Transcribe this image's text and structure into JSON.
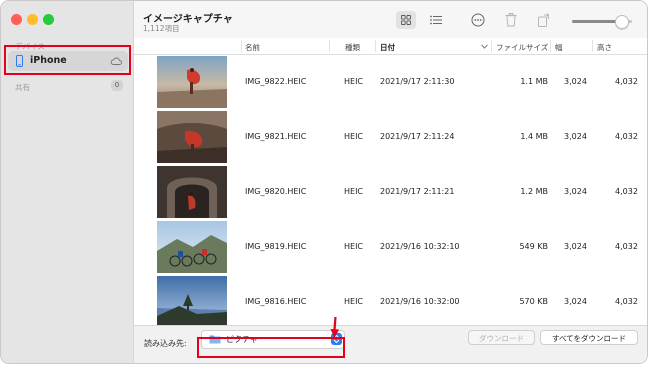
{
  "sidebar": {
    "devices_section": "デバイス",
    "device_name": "iPhone",
    "shared_section": "共有",
    "shared_count": "0"
  },
  "toolbar": {
    "title": "イメージキャプチャ",
    "subtitle": "1,112項目",
    "icons": [
      "grid-view-icon",
      "list-view-icon",
      "more-icon",
      "trash-icon",
      "rotate-icon"
    ],
    "zoom_level": 0.9
  },
  "table": {
    "headers": {
      "name": "名前",
      "kind": "種類",
      "date": "日付",
      "size": "ファイルサイズ",
      "width": "幅",
      "height": "高さ"
    },
    "rows": [
      {
        "name": "IMG_9822.HEIC",
        "kind": "HEIC",
        "date": "2021/9/17 2:11:30",
        "size": "1.1 MB",
        "width": "3,024",
        "height": "4,032"
      },
      {
        "name": "IMG_9821.HEIC",
        "kind": "HEIC",
        "date": "2021/9/17 2:11:24",
        "size": "1.4 MB",
        "width": "3,024",
        "height": "4,032"
      },
      {
        "name": "IMG_9820.HEIC",
        "kind": "HEIC",
        "date": "2021/9/17 2:11:21",
        "size": "1.2 MB",
        "width": "3,024",
        "height": "4,032"
      },
      {
        "name": "IMG_9819.HEIC",
        "kind": "HEIC",
        "date": "2021/9/16 10:32:10",
        "size": "549 KB",
        "width": "3,024",
        "height": "4,032"
      },
      {
        "name": "IMG_9816.HEIC",
        "kind": "HEIC",
        "date": "2021/9/16 10:32:00",
        "size": "570 KB",
        "width": "3,024",
        "height": "4,032"
      }
    ]
  },
  "footer": {
    "import_to_label": "読み込み先:",
    "destination": "ピクチャ",
    "download_button": "ダウンロード",
    "download_all_button": "すべてをダウンロード"
  },
  "colors": {
    "accent": "#2f7bf2",
    "highlight": "#e5001c"
  }
}
